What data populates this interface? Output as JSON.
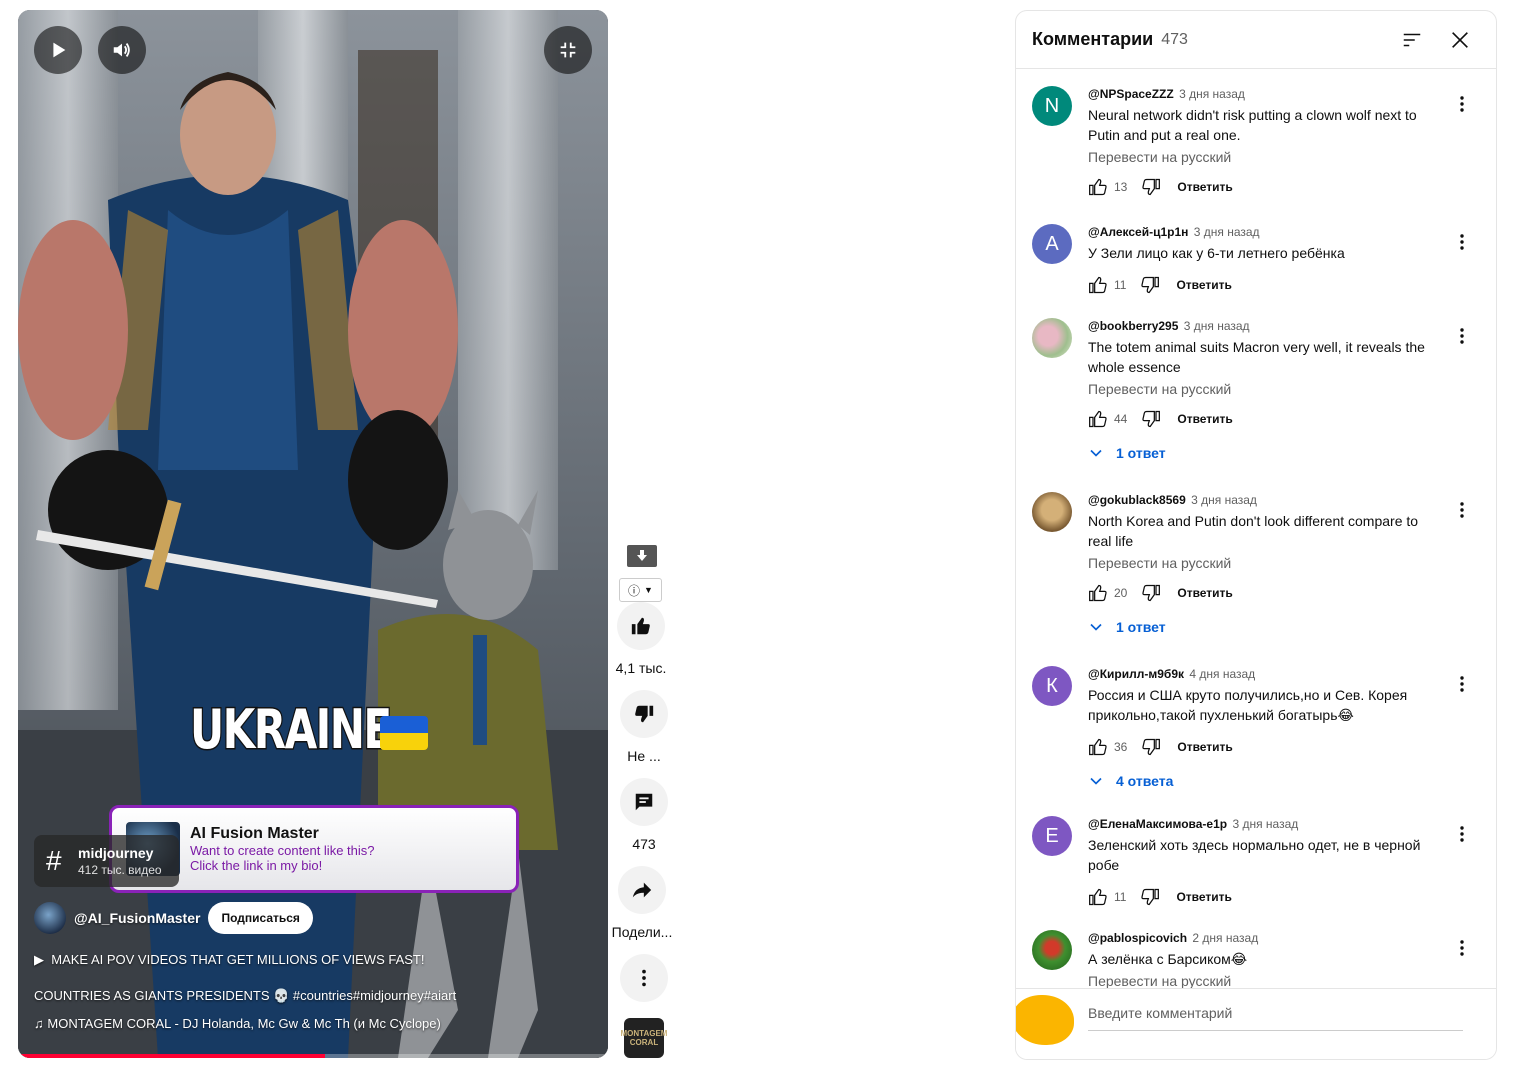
{
  "player": {
    "overlay_word": "UKRAINE",
    "tag": {
      "name": "midjourney",
      "count": "412 тыс. видео"
    },
    "promo": {
      "name": "AI Fusion Master",
      "line1": "Want to create content like this?",
      "line2": "Click the link in my bio!"
    },
    "channel": {
      "handle": "@AI_FusionMaster",
      "subscribe_label": "Подписаться"
    },
    "description": "MAKE AI POV VIDEOS THAT GET MILLIONS OF VIEWS FAST!",
    "title": "COUNTRIES AS GIANTS PRESIDENTS 💀 #countries#midjourney#aiart",
    "music": "MONTAGEM CORAL - DJ Holanda, Mc Gw & Mc Th (и Mc Cyclope)",
    "progress_fraction": 0.52
  },
  "rail": {
    "like_count": "4,1 тыс.",
    "dislike_label": "Не ...",
    "comments_count": "473",
    "share_label": "Подели...",
    "music_thumb_label": "MONTAGEM CORAL"
  },
  "panel": {
    "title": "Комментарии",
    "count": "473",
    "compose_placeholder": "Введите комментарий"
  },
  "comments": [
    {
      "avatar_letter": "N",
      "avatar_color": "#00897b",
      "author": "@NPSpaceZZZ",
      "time": "3 дня назад",
      "text": "Neural network didn't risk putting a clown wolf next to Putin and put a real one.",
      "translate": "Перевести на русский",
      "likes": "13",
      "reply": "Ответить",
      "replies": ""
    },
    {
      "avatar_letter": "A",
      "avatar_color": "#5c6bc0",
      "author": "@Алексей-ц1р1н",
      "time": "3 дня назад",
      "text": "У Зели лицо как у 6-ти летнего ребёнка",
      "translate": "",
      "likes": "11",
      "reply": "Ответить",
      "replies": ""
    },
    {
      "avatar_letter": "",
      "avatar_color": "#b9cfa5",
      "author": "@bookberry295",
      "time": "3 дня назад",
      "text": "The totem animal suits Macron very well, it reveals the whole essence",
      "translate": "Перевести на русский",
      "likes": "44",
      "reply": "Ответить",
      "replies": "1 ответ"
    },
    {
      "avatar_letter": "",
      "avatar_color": "#8a6a3c",
      "author": "@gokublack8569",
      "time": "3 дня назад",
      "text": "North Korea and Putin don't look different compare to real life",
      "translate": "Перевести на русский",
      "likes": "20",
      "reply": "Ответить",
      "replies": "1 ответ"
    },
    {
      "avatar_letter": "К",
      "avatar_color": "#7e57c2",
      "author": "@Кирилл-м9б9к",
      "time": "4 дня назад",
      "text": "Россия и США круто получились,но и Сев. Корея прикольно,такой пухленький богатырь😂",
      "translate": "",
      "likes": "36",
      "reply": "Ответить",
      "replies": "4 ответа"
    },
    {
      "avatar_letter": "E",
      "avatar_color": "#7e57c2",
      "author": "@ЕленаМаксимова-е1р",
      "time": "3 дня назад",
      "text": "Зеленский хоть здесь нормально одет, не в черной робе",
      "translate": "",
      "likes": "11",
      "reply": "Ответить",
      "replies": ""
    },
    {
      "avatar_letter": "",
      "avatar_color": "#2e7d32",
      "author": "@pablospicovich",
      "time": "2 дня назад",
      "text": "А зелёнка с Барсиком😂",
      "translate": "Перевести на русский",
      "likes": "",
      "reply": "",
      "replies": ""
    }
  ]
}
